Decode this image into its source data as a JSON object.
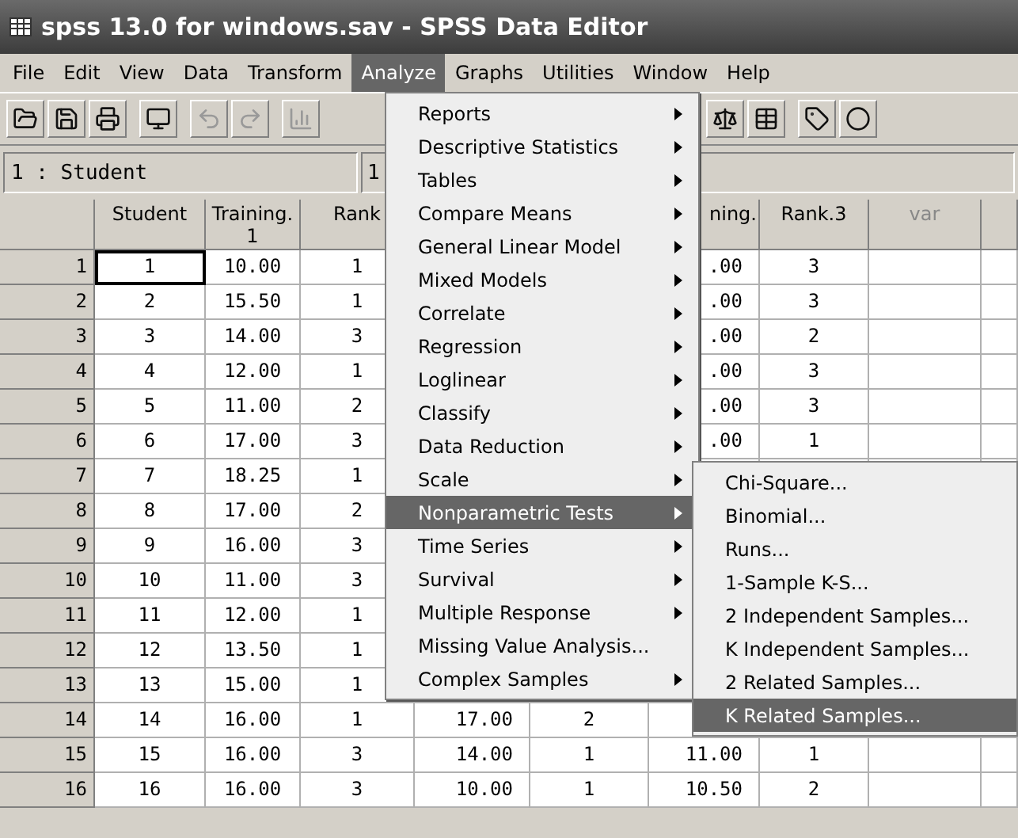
{
  "window": {
    "title": "spss 13.0 for windows.sav - SPSS Data Editor"
  },
  "menu_bar": [
    {
      "label": "File",
      "selected": false
    },
    {
      "label": "Edit",
      "selected": false
    },
    {
      "label": "View",
      "selected": false
    },
    {
      "label": "Data",
      "selected": false
    },
    {
      "label": "Transform",
      "selected": false
    },
    {
      "label": "Analyze",
      "selected": true
    },
    {
      "label": "Graphs",
      "selected": false
    },
    {
      "label": "Utilities",
      "selected": false
    },
    {
      "label": "Window",
      "selected": false
    },
    {
      "label": "Help",
      "selected": false
    }
  ],
  "cell_editor": {
    "cell_ref": "1 : Student",
    "value": "1"
  },
  "table": {
    "columns": [
      "Student",
      "Training.\n1",
      "Rank",
      null,
      null,
      "ning.",
      "Rank.3",
      "var"
    ],
    "rows": [
      {
        "row": "1",
        "selected": true,
        "cells": [
          "1",
          "10.00",
          "1",
          null,
          null,
          ".00",
          "3",
          null
        ]
      },
      {
        "row": "2",
        "selected": false,
        "cells": [
          "2",
          "15.50",
          "1",
          null,
          null,
          ".00",
          "3",
          null
        ]
      },
      {
        "row": "3",
        "selected": false,
        "cells": [
          "3",
          "14.00",
          "3",
          null,
          null,
          ".00",
          "2",
          null
        ]
      },
      {
        "row": "4",
        "selected": false,
        "cells": [
          "4",
          "12.00",
          "1",
          null,
          null,
          ".00",
          "3",
          null
        ]
      },
      {
        "row": "5",
        "selected": false,
        "cells": [
          "5",
          "11.00",
          "2",
          null,
          null,
          ".00",
          "3",
          null
        ]
      },
      {
        "row": "6",
        "selected": false,
        "cells": [
          "6",
          "17.00",
          "3",
          null,
          null,
          ".00",
          "1",
          null
        ]
      },
      {
        "row": "7",
        "selected": false,
        "cells": [
          "7",
          "18.25",
          "1",
          null,
          null,
          null,
          null,
          null
        ]
      },
      {
        "row": "8",
        "selected": false,
        "cells": [
          "8",
          "17.00",
          "2",
          null,
          null,
          null,
          null,
          null
        ]
      },
      {
        "row": "9",
        "selected": false,
        "cells": [
          "9",
          "16.00",
          "3",
          null,
          null,
          null,
          null,
          null
        ]
      },
      {
        "row": "10",
        "selected": false,
        "cells": [
          "10",
          "11.00",
          "3",
          null,
          null,
          null,
          null,
          null
        ]
      },
      {
        "row": "11",
        "selected": false,
        "cells": [
          "11",
          "12.00",
          "1",
          null,
          null,
          null,
          null,
          null
        ]
      },
      {
        "row": "12",
        "selected": false,
        "cells": [
          "12",
          "13.50",
          "1",
          null,
          null,
          null,
          null,
          null
        ]
      },
      {
        "row": "13",
        "selected": false,
        "cells": [
          "13",
          "15.00",
          "1",
          null,
          null,
          null,
          null,
          null
        ]
      },
      {
        "row": "14",
        "selected": false,
        "cells": [
          "14",
          "16.00",
          "1",
          "17.00",
          "2",
          null,
          null,
          null
        ]
      },
      {
        "row": "15",
        "selected": false,
        "cells": [
          "15",
          "16.00",
          "3",
          "14.00",
          "1",
          "11.00",
          "1",
          null
        ]
      },
      {
        "row": "16",
        "selected": false,
        "cells": [
          "16",
          "16.00",
          "3",
          "10.00",
          "1",
          "10.50",
          "2",
          null
        ]
      }
    ]
  },
  "analyze_menu": {
    "items": [
      {
        "label": "Reports",
        "submenu": true,
        "selected": false
      },
      {
        "label": "Descriptive Statistics",
        "submenu": true,
        "selected": false
      },
      {
        "label": "Tables",
        "submenu": true,
        "selected": false
      },
      {
        "label": "Compare Means",
        "submenu": true,
        "selected": false
      },
      {
        "label": "General Linear Model",
        "submenu": true,
        "selected": false
      },
      {
        "label": "Mixed Models",
        "submenu": true,
        "selected": false
      },
      {
        "label": "Correlate",
        "submenu": true,
        "selected": false
      },
      {
        "label": "Regression",
        "submenu": true,
        "selected": false
      },
      {
        "label": "Loglinear",
        "submenu": true,
        "selected": false
      },
      {
        "label": "Classify",
        "submenu": true,
        "selected": false
      },
      {
        "label": "Data Reduction",
        "submenu": true,
        "selected": false
      },
      {
        "label": "Scale",
        "submenu": true,
        "selected": false
      },
      {
        "label": "Nonparametric Tests",
        "submenu": true,
        "selected": true
      },
      {
        "label": "Time Series",
        "submenu": true,
        "selected": false
      },
      {
        "label": "Survival",
        "submenu": true,
        "selected": false
      },
      {
        "label": "Multiple Response",
        "submenu": true,
        "selected": false
      },
      {
        "label": "Missing Value Analysis...",
        "submenu": false,
        "selected": false
      },
      {
        "label": "Complex Samples",
        "submenu": true,
        "selected": false
      }
    ]
  },
  "nonparametric_submenu": {
    "items": [
      {
        "label": "Chi-Square...",
        "selected": false
      },
      {
        "label": "Binomial...",
        "selected": false
      },
      {
        "label": "Runs...",
        "selected": false
      },
      {
        "label": "1-Sample K-S...",
        "selected": false
      },
      {
        "label": "2 Independent Samples...",
        "selected": false
      },
      {
        "label": "K Independent Samples...",
        "selected": false
      },
      {
        "label": "2 Related Samples...",
        "selected": false
      },
      {
        "label": "K Related Samples...",
        "selected": true
      }
    ]
  }
}
